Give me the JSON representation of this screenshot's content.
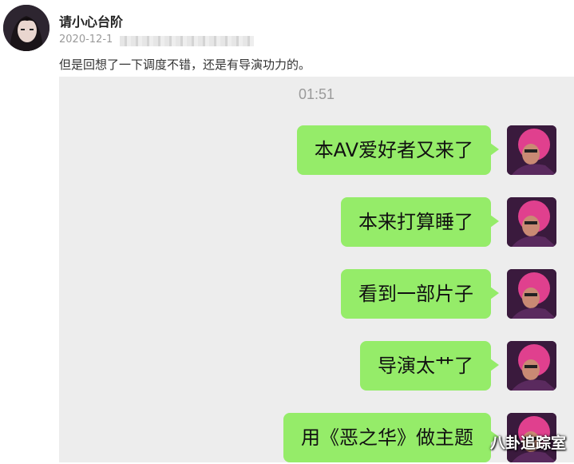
{
  "post": {
    "username": "请小心台阶",
    "date": "2020-12-1",
    "text": "但是回想了一下调度不错，还是有导演功力的。"
  },
  "chat": {
    "time": "01:51",
    "messages": [
      "本AV爱好者又来了",
      "本来打算睡了",
      "看到一部片子",
      "导演太艹了",
      "用《恶之华》做主题"
    ]
  },
  "watermark": "八卦追踪室",
  "colors": {
    "bubble": "#95ec69",
    "chat_bg": "#ededed"
  }
}
